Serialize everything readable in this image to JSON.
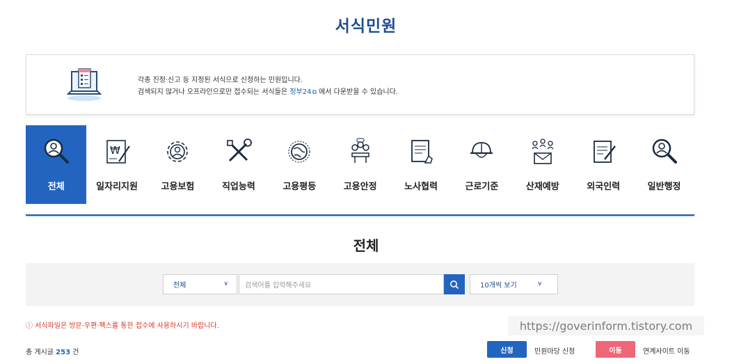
{
  "page_title": "서식민원",
  "info": {
    "line1": "각종 진정·신고 등 지정된 서식으로 신청하는 민원입니다.",
    "line2_prefix": "검색되지 않거나 오프라인으로만 접수되는 서식들은",
    "link": "정부24",
    "line2_suffix": "에서 다운받을 수 있습니다."
  },
  "categories": [
    {
      "label": "전체",
      "icon": "search-person-icon",
      "active": true
    },
    {
      "label": "일자리지원",
      "icon": "won-document-icon"
    },
    {
      "label": "고용보험",
      "icon": "gear-person-icon"
    },
    {
      "label": "직업능력",
      "icon": "tools-icon"
    },
    {
      "label": "고용평등",
      "icon": "globe-icon"
    },
    {
      "label": "고용안정",
      "icon": "meeting-icon"
    },
    {
      "label": "노사협력",
      "icon": "document-hand-icon"
    },
    {
      "label": "근로기준",
      "icon": "helmet-icon"
    },
    {
      "label": "산재예방",
      "icon": "people-mail-icon"
    },
    {
      "label": "외국인력",
      "icon": "document-pen-icon"
    },
    {
      "label": "일반행정",
      "icon": "search-person-icon"
    }
  ],
  "section_title": "전체",
  "search": {
    "category_value": "전체",
    "placeholder": "검색어를 입력해주세요",
    "per_page_value": "10개씩 보기"
  },
  "notice": "ⓘ 서식파일은 방문·우편·팩스를 통한 접수에 사용하시기 바랍니다.",
  "watermark": "https://goverinform.tistory.com",
  "total": {
    "prefix": "총 게시글",
    "count": "253",
    "suffix": "건"
  },
  "buttons": {
    "apply": "신청",
    "apply_text": "민원마당 신청",
    "move": "이동",
    "move_text": "연계사이트 이동"
  },
  "colors": {
    "primary": "#2264c0",
    "title": "#1f4e8c",
    "notice": "#d33a2c",
    "move": "#ee6677"
  }
}
